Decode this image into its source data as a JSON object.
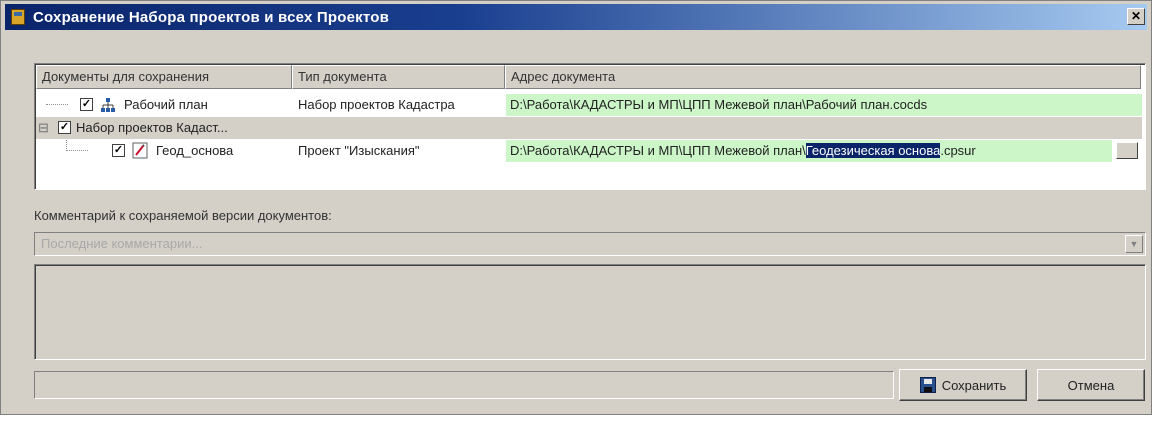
{
  "window": {
    "title": "Сохранение Набора проектов и всех Проектов",
    "close_glyph": "✕"
  },
  "grid": {
    "columns": [
      "Документы для сохранения",
      "Тип документа",
      "Адрес документа"
    ],
    "rows": [
      {
        "name": "Рабочий план",
        "type": "Набор проектов Кадастра",
        "address": "D:\\Работа\\КАДАСТРЫ и МП\\ЦПП Межевой план\\Рабочий план.cocds",
        "checked": true,
        "icon": "network-tree-icon"
      },
      {
        "name": "Набор проектов Кадаст...",
        "type": "",
        "address": "",
        "checked": true,
        "expanded": true,
        "toggle": "⊟"
      },
      {
        "name": "Геод_основа",
        "type": "Проект \"Изыскания\"",
        "address_prefix": "D:\\Работа\\КАДАСТРЫ и МП\\ЦПП Межевой план\\",
        "address_selected": "Геодезическая основа",
        "address_suffix": ".cpsur",
        "checked": true,
        "icon": "survey-project-icon"
      }
    ]
  },
  "comment": {
    "label": "Комментарий к сохраняемой версии документов:",
    "placeholder": "Последние комментарии...",
    "dropdown_glyph": "▼"
  },
  "buttons": {
    "save": "Сохранить",
    "cancel": "Отмена"
  },
  "check_glyph": "✓",
  "colors": {
    "title_bar": "#0a246a",
    "path_highlight": "#ccf5c8",
    "selection": "#0a246a",
    "face": "#d4d0c8"
  }
}
